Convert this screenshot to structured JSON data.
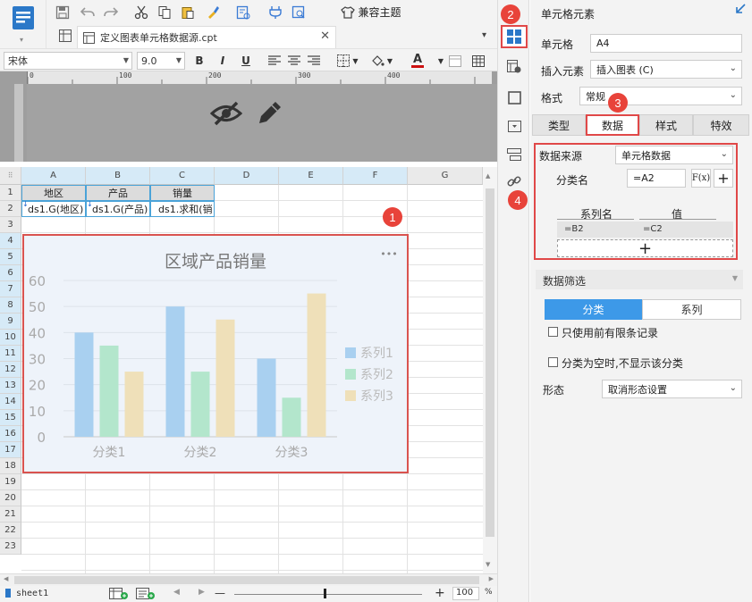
{
  "toolbar": {
    "theme_label": "兼容主题"
  },
  "file_tab": {
    "name": "定义图表单元格数据源.cpt"
  },
  "format_bar": {
    "font": "宋体",
    "font_size": "9.0",
    "bold": "B",
    "italic": "I",
    "underline": "U",
    "font_color_glyph": "A"
  },
  "ruler": {
    "ticks": [
      "0",
      "100",
      "200",
      "300",
      "400"
    ]
  },
  "sheet": {
    "columns": [
      "A",
      "B",
      "C",
      "D",
      "E",
      "F",
      "G"
    ],
    "rows": [
      "1",
      "2",
      "3",
      "4",
      "5",
      "6",
      "7",
      "8",
      "9",
      "10",
      "11",
      "12",
      "13",
      "14",
      "15",
      "16",
      "17",
      "18",
      "19",
      "20",
      "21",
      "22",
      "23"
    ],
    "row1": [
      "地区",
      "产品",
      "销量"
    ],
    "row2": [
      "ds1.G(地区)",
      "ds1.G(产品)",
      "ds1.求和(销"
    ]
  },
  "chart_data": {
    "type": "bar",
    "title": "区域产品销量",
    "categories": [
      "分类1",
      "分类2",
      "分类3"
    ],
    "series": [
      {
        "name": "系列1",
        "values": [
          40,
          50,
          30
        ],
        "color": "#a9d0f0"
      },
      {
        "name": "系列2",
        "values": [
          35,
          25,
          15
        ],
        "color": "#b3e6cc"
      },
      {
        "name": "系列3",
        "values": [
          25,
          45,
          55
        ],
        "color": "#efe0b9"
      }
    ],
    "ylim": [
      0,
      60
    ],
    "yticks": [
      "0",
      "10",
      "20",
      "30",
      "40",
      "50",
      "60"
    ],
    "grid": true,
    "legend": "right",
    "more_glyph": "•••"
  },
  "status": {
    "sheet_name": "sheet1",
    "zoom": "100",
    "percent": "%",
    "minus": "—",
    "plus": "+"
  },
  "panel": {
    "title": "单元格元素",
    "cell_label": "单元格",
    "cell_value": "A4",
    "insert_label": "插入元素",
    "insert_value": "插入图表 (C)",
    "format_label": "格式",
    "format_value": "常规",
    "tabs": [
      "类型",
      "数据",
      "样式",
      "特效"
    ],
    "source_label": "数据来源",
    "source_value": "单元格数据",
    "category_label": "分类名",
    "category_value": "=A2",
    "fx": "F(x)",
    "add": "+",
    "series_header_name": "系列名",
    "series_header_value": "值",
    "series_row_name": "=B2",
    "series_row_value": "=C2",
    "add_row": "+",
    "filter_title": "数据筛选",
    "filter_tabs": [
      "分类",
      "系列"
    ],
    "check1": "只使用前有限条记录",
    "check2": "分类为空时,不显示该分类",
    "shape_label": "形态",
    "shape_value": "取消形态设置"
  },
  "badges": [
    "1",
    "2",
    "3",
    "4"
  ]
}
